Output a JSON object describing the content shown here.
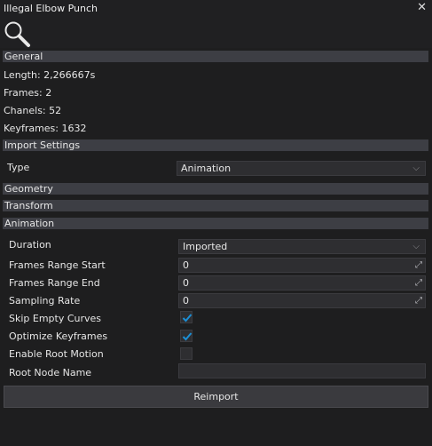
{
  "window": {
    "title": "Illegal Elbow Punch",
    "close_glyph": "✕"
  },
  "toolbar": {
    "search_icon": "magnifier-icon"
  },
  "general": {
    "header": "General",
    "length": "Length: 2,266667s",
    "frames": "Frames: 2",
    "channels": "Chanels: 52",
    "keyframes": "Keyframes: 1632"
  },
  "import_settings": {
    "header": "Import Settings",
    "type_label": "Type",
    "type_value": "Animation"
  },
  "sections": {
    "geometry": "Geometry",
    "transform": "Transform",
    "animation": "Animation"
  },
  "animation": {
    "duration_label": "Duration",
    "duration_value": "Imported",
    "frames_range_start_label": "Frames Range Start",
    "frames_range_start_value": "0",
    "frames_range_end_label": "Frames Range End",
    "frames_range_end_value": "0",
    "sampling_rate_label": "Sampling Rate",
    "sampling_rate_value": "0",
    "skip_empty_curves_label": "Skip Empty Curves",
    "skip_empty_curves_checked": true,
    "optimize_keyframes_label": "Optimize Keyframes",
    "optimize_keyframes_checked": true,
    "enable_root_motion_label": "Enable Root Motion",
    "enable_root_motion_checked": false,
    "root_node_name_label": "Root Node Name",
    "root_node_name_value": ""
  },
  "reimport_label": "Reimport",
  "colors": {
    "accent": "#1b8fd6",
    "section_header": "#3d3e44",
    "background": "#1e1e1f"
  }
}
